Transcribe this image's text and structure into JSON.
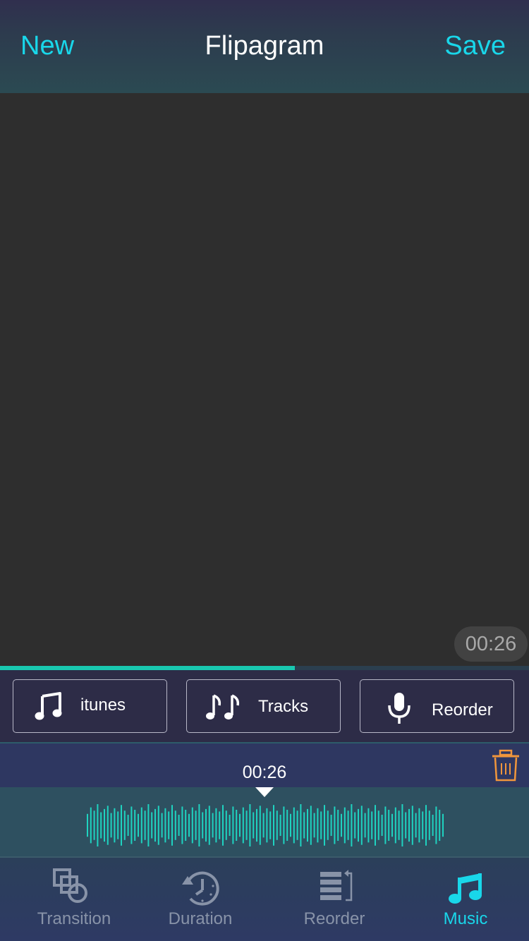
{
  "header": {
    "new_label": "New",
    "title": "Flipagram",
    "save_label": "Save"
  },
  "preview": {
    "duration": "00:26",
    "progress_fraction": 0.557
  },
  "sources": [
    {
      "label": "itunes",
      "icon": "music-note-icon"
    },
    {
      "label": "Tracks",
      "icon": "double-music-note-icon"
    },
    {
      "label": "Reorder",
      "icon": "microphone-icon"
    }
  ],
  "timeline": {
    "current_time": "00:26",
    "delete_icon": "trash-icon"
  },
  "tabs": [
    {
      "label": "Transition",
      "icon": "transition-shapes-icon",
      "active": false
    },
    {
      "label": "Duration",
      "icon": "clock-icon",
      "active": false
    },
    {
      "label": "Reorder",
      "icon": "reorder-list-icon",
      "active": false
    },
    {
      "label": "Music",
      "icon": "music-note-icon",
      "active": true
    }
  ],
  "colors": {
    "accent": "#19d7ea",
    "wave": "#1fd3c0",
    "progress": "#19c8b0",
    "trash": "#f0963c",
    "inactive_tab": "#8893a8"
  }
}
